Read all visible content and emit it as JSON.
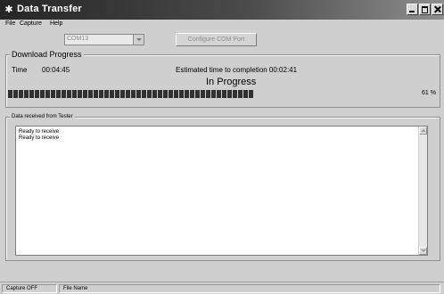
{
  "window": {
    "title": "Data Transfer"
  },
  "menu": {
    "file": "File",
    "capture": "Capture",
    "help": "Help"
  },
  "toolbar": {
    "com_port_value": "COM13",
    "configure_button": "Configure COM Port"
  },
  "download": {
    "legend": "Download Progress",
    "time_label": "Time",
    "time_value": "00:04:45",
    "eta_text": "Estimated time to completion 00:02:41",
    "status": "In Progress",
    "percent_text": "61 %",
    "progress_fraction": 0.61
  },
  "received": {
    "legend": "Data received from Tester",
    "lines": [
      "Ready to receive",
      "Ready to receive"
    ]
  },
  "statusbar": {
    "capture": "Capture OFF",
    "file": "File Name"
  },
  "colors": {
    "titlebar_start": "#262626",
    "titlebar_end": "#8e8e8e",
    "window_bg": "#cfcfcf",
    "progress_block": "#303030"
  },
  "icons": [
    "app-icon",
    "minimize-icon",
    "maximize-icon",
    "close-icon",
    "chevron-down-icon",
    "scroll-up-icon",
    "scroll-down-icon"
  ]
}
